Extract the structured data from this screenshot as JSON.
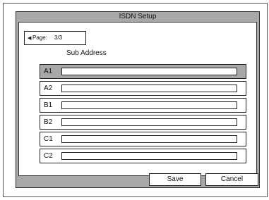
{
  "window": {
    "title": "ISDN Setup"
  },
  "pager": {
    "arrow_icon": "left-triangle-icon",
    "label": "Page:",
    "value": "3/3"
  },
  "section": {
    "heading": "Sub Address"
  },
  "rows": [
    {
      "label": "A1",
      "value": "",
      "selected": true
    },
    {
      "label": "A2",
      "value": "",
      "selected": false
    },
    {
      "label": "B1",
      "value": "",
      "selected": false
    },
    {
      "label": "B2",
      "value": "",
      "selected": false
    },
    {
      "label": "C1",
      "value": "",
      "selected": false
    },
    {
      "label": "C2",
      "value": "",
      "selected": false
    }
  ],
  "buttons": {
    "save": "Save",
    "cancel": "Cancel"
  },
  "colors": {
    "chrome": "#a8a8a8",
    "panel": "#ffffff",
    "selected_row": "#a8a8a8",
    "border": "#222222"
  }
}
